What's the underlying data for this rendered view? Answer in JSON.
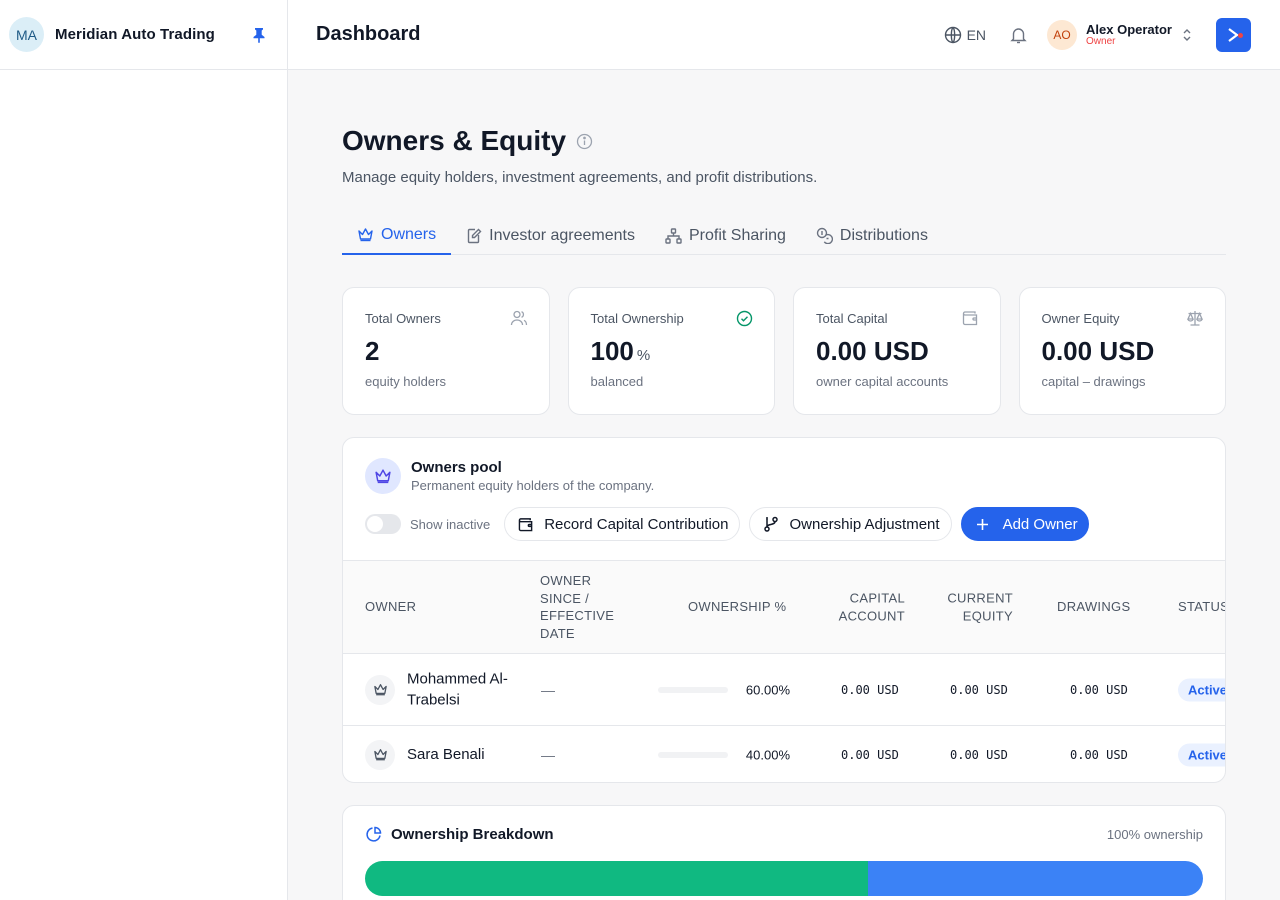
{
  "sidebar": {
    "org_initials": "MA",
    "org_name": "Meridian Auto Trading"
  },
  "topbar": {
    "page_title": "Dashboard",
    "language": "EN",
    "user": {
      "initials": "AO",
      "name": "Alex Operator",
      "role": "Owner"
    }
  },
  "page": {
    "title": "Owners & Equity",
    "subtitle": "Manage equity holders, investment agreements, and profit distributions."
  },
  "tabs": [
    {
      "label": "Owners",
      "icon": "crown-icon",
      "active": true
    },
    {
      "label": "Investor agreements",
      "icon": "file-edit-icon",
      "active": false
    },
    {
      "label": "Profit Sharing",
      "icon": "network-icon",
      "active": false
    },
    {
      "label": "Distributions",
      "icon": "coins-icon",
      "active": false
    }
  ],
  "stats": [
    {
      "label": "Total Owners",
      "value": "2",
      "unit": "",
      "sub": "equity holders",
      "icon": "users-icon"
    },
    {
      "label": "Total Ownership",
      "value": "100",
      "unit": "%",
      "sub": "balanced",
      "icon": "check-circle-icon"
    },
    {
      "label": "Total Capital",
      "value": "0.00 USD",
      "unit": "",
      "sub": "owner capital accounts",
      "icon": "wallet-icon"
    },
    {
      "label": "Owner Equity",
      "value": "0.00 USD",
      "unit": "",
      "sub": "capital – drawings",
      "icon": "scale-icon"
    }
  ],
  "pool": {
    "title": "Owners pool",
    "description": "Permanent equity holders of the company.",
    "show_inactive_label": "Show inactive",
    "show_inactive": false,
    "record_capital_label": "Record Capital Contribution",
    "adjustment_label": "Ownership Adjustment",
    "add_owner_label": "Add Owner"
  },
  "table": {
    "columns": {
      "owner": "OWNER",
      "since": "OWNER SINCE / EFFECTIVE DATE",
      "ownership": "OWNERSHIP %",
      "capital": "CAPITAL ACCOUNT",
      "equity": "CURRENT EQUITY",
      "drawings": "DRAWINGS",
      "status": "STATUS"
    },
    "rows": [
      {
        "name": "Mohammed Al-Trabelsi",
        "since": "—",
        "ownership_pct": 60,
        "ownership": "60.00%",
        "capital": "0.00 USD",
        "equity": "0.00 USD",
        "drawings": "0.00 USD",
        "status": "Active"
      },
      {
        "name": "Sara Benali",
        "since": "—",
        "ownership_pct": 40,
        "ownership": "40.00%",
        "capital": "0.00 USD",
        "equity": "0.00 USD",
        "drawings": "0.00 USD",
        "status": "Active"
      }
    ]
  },
  "breakdown": {
    "title": "Ownership Breakdown",
    "summary": "100% ownership",
    "segments": [
      {
        "owner": "Mohammed Al-Trabelsi",
        "pct": 60,
        "color": "#10b981"
      },
      {
        "owner": "Sara Benali",
        "pct": 40,
        "color": "#3b82f6"
      }
    ]
  },
  "colors": {
    "accent": "#2563eb",
    "success": "#10b981",
    "danger": "#ef4444"
  }
}
